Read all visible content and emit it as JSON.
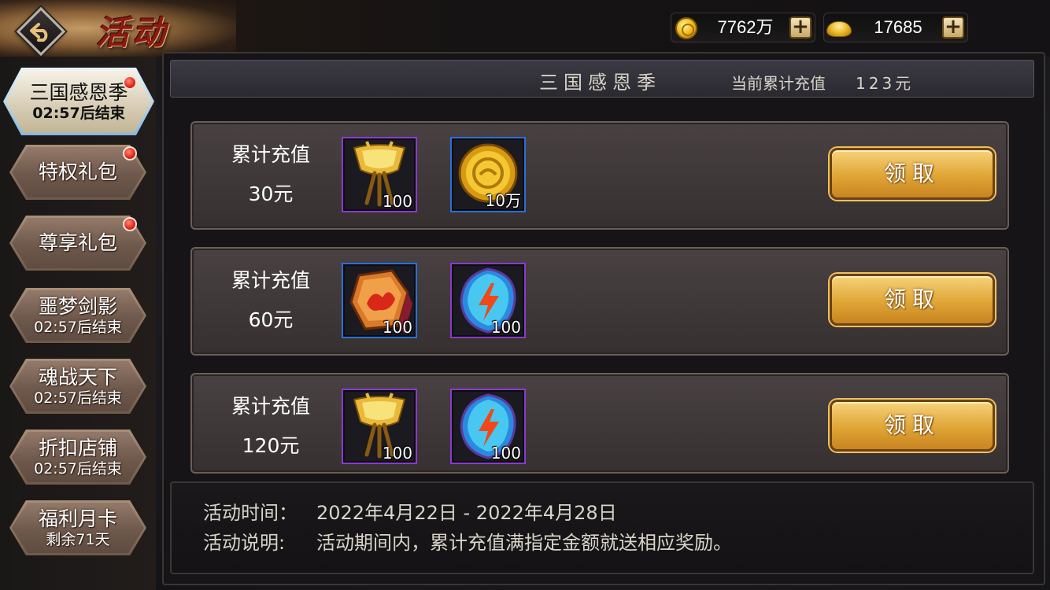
{
  "header": {
    "title": "活动",
    "gold": "7762万",
    "ingot": "17685"
  },
  "sidebar": {
    "items": [
      {
        "label": "三国感恩季",
        "sub": "02:57后结束"
      },
      {
        "label": "特权礼包",
        "sub": ""
      },
      {
        "label": "尊享礼包",
        "sub": ""
      },
      {
        "label": "噩梦剑影",
        "sub": "02:57后结束"
      },
      {
        "label": "魂战天下",
        "sub": "02:57后结束"
      },
      {
        "label": "折扣店铺",
        "sub": "02:57后结束"
      },
      {
        "label": "福利月卡",
        "sub": "剩余71天"
      }
    ]
  },
  "panel": {
    "title": "三国感恩季",
    "total_label": "当前累计充值",
    "total_value": "123元"
  },
  "rewards": [
    {
      "label": "累计充值",
      "amount": "30元",
      "items": [
        {
          "icon": "golden-goblet-icon",
          "qty": "100"
        },
        {
          "icon": "gold-coin-icon",
          "qty": "10万"
        }
      ],
      "button": "领取"
    },
    {
      "label": "累计充值",
      "amount": "60元",
      "items": [
        {
          "icon": "fire-stone-icon",
          "qty": "100"
        },
        {
          "icon": "lightning-gem-icon",
          "qty": "100"
        }
      ],
      "button": "领取"
    },
    {
      "label": "累计充值",
      "amount": "120元",
      "items": [
        {
          "icon": "golden-goblet-icon",
          "qty": "100"
        },
        {
          "icon": "lightning-gem-icon",
          "qty": "100"
        }
      ],
      "button": "领取"
    }
  ],
  "footer": {
    "time_label": "活动时间：",
    "time_value": "2022年4月22日 - 2022年4月28日",
    "desc_label": "活动说明:",
    "desc_value": "活动期间内，累计充值满指定金额就送相应奖励。"
  }
}
